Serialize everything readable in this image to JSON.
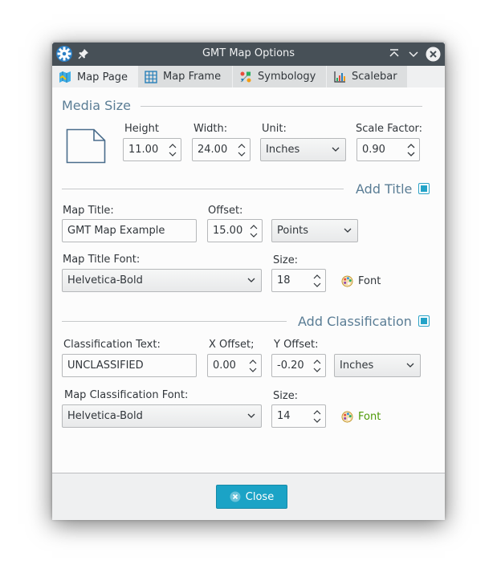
{
  "window": {
    "title": "GMT Map Options"
  },
  "tabs": [
    {
      "label": "Map Page",
      "icon": "map-icon"
    },
    {
      "label": "Map Frame",
      "icon": "grid-icon"
    },
    {
      "label": "Symbology",
      "icon": "symbology-icon"
    },
    {
      "label": "Scalebar",
      "icon": "scalebar-icon"
    }
  ],
  "media_size": {
    "section_title": "Media Size",
    "height_label": "Height",
    "height_value": "11.00",
    "width_label": "Width:",
    "width_value": "24.00",
    "unit_label": "Unit:",
    "unit_value": "Inches",
    "scale_label": "Scale Factor:",
    "scale_value": "0.90"
  },
  "title_section": {
    "section_title": "Add Title",
    "enabled": true,
    "map_title_label": "Map Title:",
    "map_title_value": "GMT Map Example",
    "offset_label": "Offset:",
    "offset_value": "15.00",
    "offset_unit": "Points",
    "font_label": "Map Title Font:",
    "font_value": "Helvetica-Bold",
    "size_label": "Size:",
    "size_value": "18",
    "font_button": "Font"
  },
  "classification": {
    "section_title": "Add Classification",
    "enabled": true,
    "text_label": "Classification Text:",
    "text_value": "UNCLASSIFIED",
    "x_offset_label": "X Offset;",
    "x_offset_value": "0.00",
    "y_offset_label": "Y Offset:",
    "y_offset_value": "-0.20",
    "unit_value": "Inches",
    "font_label": "Map Classification Font:",
    "font_value": "Helvetica-Bold",
    "size_label": "Size:",
    "size_value": "14",
    "font_button": "Font",
    "font_button_color": "#4e9a06"
  },
  "footer": {
    "close_label": "Close"
  },
  "colors": {
    "accent": "#1ba3c6",
    "titlebar": "#475057",
    "section_title": "#5a7d95"
  }
}
